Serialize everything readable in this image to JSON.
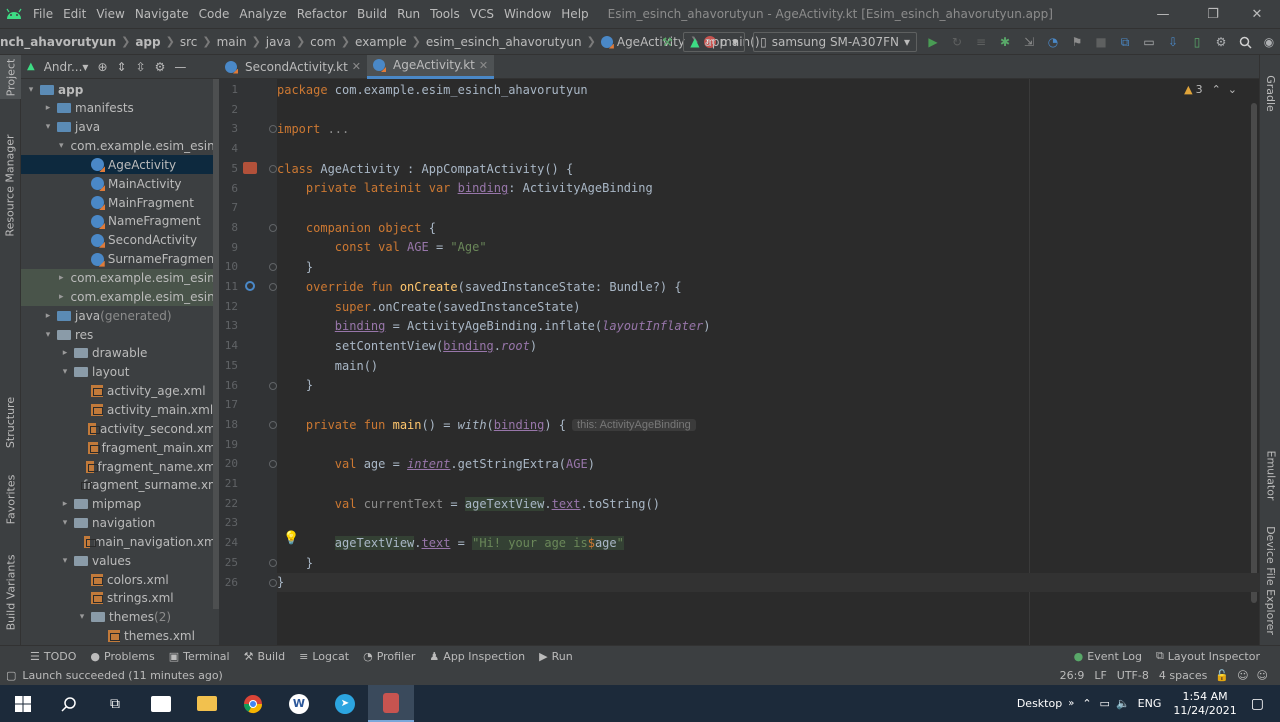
{
  "menu": {
    "items": [
      "File",
      "Edit",
      "View",
      "Navigate",
      "Code",
      "Analyze",
      "Refactor",
      "Build",
      "Run",
      "Tools",
      "VCS",
      "Window",
      "Help"
    ],
    "title": "Esim_esinch_ahavorutyun - AgeActivity.kt [Esim_esinch_ahavorutyun.app]"
  },
  "nav": {
    "crumbs": [
      "nch_ahavorutyun",
      "app",
      "src",
      "main",
      "java",
      "com",
      "example",
      "esim_esinch_ahavorutyun",
      "AgeActivity",
      "main()"
    ],
    "run_config": "app",
    "device": "samsung SM-A307FN"
  },
  "left_tabs": {
    "project": "Project",
    "resource_manager": "Resource Manager",
    "structure": "Structure",
    "favorites": "Favorites",
    "build_variants": "Build Variants"
  },
  "right_tabs": {
    "gradle": "Gradle",
    "emulator": "Emulator",
    "device_file_explorer": "Device File Explorer"
  },
  "project": {
    "view": "Andr...▾",
    "tree": [
      {
        "label": "app",
        "extra": "",
        "arrow": "▾",
        "icon": "folder-blue",
        "indent": 0
      },
      {
        "label": "manifests",
        "extra": "",
        "arrow": "▸",
        "icon": "folder-blue",
        "indent": 1
      },
      {
        "label": "java",
        "extra": "",
        "arrow": "▾",
        "icon": "folder-blue",
        "indent": 1
      },
      {
        "label": "com.example.esim_esinch",
        "extra": "",
        "arrow": "▾",
        "icon": "package",
        "indent": 2
      },
      {
        "label": "AgeActivity",
        "extra": "",
        "arrow": "",
        "icon": "kotlin-file",
        "indent": 3,
        "state": "sel"
      },
      {
        "label": "MainActivity",
        "extra": "",
        "arrow": "",
        "icon": "kotlin-file",
        "indent": 3
      },
      {
        "label": "MainFragment",
        "extra": "",
        "arrow": "",
        "icon": "kotlin-file",
        "indent": 3
      },
      {
        "label": "NameFragment",
        "extra": "",
        "arrow": "",
        "icon": "kotlin-file",
        "indent": 3
      },
      {
        "label": "SecondActivity",
        "extra": "",
        "arrow": "",
        "icon": "kotlin-file",
        "indent": 3
      },
      {
        "label": "SurnameFragment",
        "extra": "",
        "arrow": "",
        "icon": "kotlin-file",
        "indent": 3
      },
      {
        "label": "com.example.esim_esinch",
        "extra": "",
        "arrow": "▸",
        "icon": "package",
        "indent": 2,
        "state": "hl"
      },
      {
        "label": "com.example.esim_esinch",
        "extra": "",
        "arrow": "▸",
        "icon": "package",
        "indent": 2,
        "state": "hl"
      },
      {
        "label": "java",
        "extra": " (generated)",
        "arrow": "▸",
        "icon": "folder-blue",
        "indent": 1
      },
      {
        "label": "res",
        "extra": "",
        "arrow": "▾",
        "icon": "folder",
        "indent": 1
      },
      {
        "label": "drawable",
        "extra": "",
        "arrow": "▸",
        "icon": "folder",
        "indent": 2
      },
      {
        "label": "layout",
        "extra": "",
        "arrow": "▾",
        "icon": "folder",
        "indent": 2
      },
      {
        "label": "activity_age.xml",
        "extra": "",
        "arrow": "",
        "icon": "xml",
        "indent": 3
      },
      {
        "label": "activity_main.xml",
        "extra": "",
        "arrow": "",
        "icon": "xml",
        "indent": 3
      },
      {
        "label": "activity_second.xml",
        "extra": "",
        "arrow": "",
        "icon": "xml",
        "indent": 3
      },
      {
        "label": "fragment_main.xml",
        "extra": "",
        "arrow": "",
        "icon": "xml",
        "indent": 3
      },
      {
        "label": "fragment_name.xml",
        "extra": "",
        "arrow": "",
        "icon": "xml",
        "indent": 3
      },
      {
        "label": "fragment_surname.xm",
        "extra": "",
        "arrow": "",
        "icon": "xml",
        "indent": 3
      },
      {
        "label": "mipmap",
        "extra": "",
        "arrow": "▸",
        "icon": "folder",
        "indent": 2
      },
      {
        "label": "navigation",
        "extra": "",
        "arrow": "▾",
        "icon": "folder",
        "indent": 2
      },
      {
        "label": "main_navigation.xml",
        "extra": "",
        "arrow": "",
        "icon": "xml",
        "indent": 3
      },
      {
        "label": "values",
        "extra": "",
        "arrow": "▾",
        "icon": "folder",
        "indent": 2
      },
      {
        "label": "colors.xml",
        "extra": "",
        "arrow": "",
        "icon": "xml",
        "indent": 3
      },
      {
        "label": "strings.xml",
        "extra": "",
        "arrow": "",
        "icon": "xml",
        "indent": 3
      },
      {
        "label": "themes",
        "extra": " (2)",
        "arrow": "▾",
        "icon": "folder",
        "indent": 3
      },
      {
        "label": "themes.xml",
        "extra": "",
        "arrow": "",
        "icon": "xml",
        "indent": 4
      }
    ]
  },
  "tabs": [
    {
      "label": "SecondActivity.kt",
      "active": false
    },
    {
      "label": "AgeActivity.kt",
      "active": true
    }
  ],
  "editor": {
    "warnings": "3",
    "current_line": 26,
    "lines": [
      [
        [
          "kw",
          "package "
        ],
        [
          "",
          "com.example.esim_esinch_ahavorutyun"
        ]
      ],
      [],
      [
        [
          "kw",
          "import "
        ],
        [
          "muted",
          "..."
        ]
      ],
      [],
      [
        [
          "kw",
          "class "
        ],
        [
          "",
          "AgeActivity : AppCompatActivity() {"
        ]
      ],
      [
        [
          "",
          "    "
        ],
        [
          "kw",
          "private lateinit var "
        ],
        [
          "prop ul",
          "binding"
        ],
        [
          "",
          ": ActivityAgeBinding"
        ]
      ],
      [],
      [
        [
          "",
          "    "
        ],
        [
          "kw",
          "companion object "
        ],
        [
          "",
          "{"
        ]
      ],
      [
        [
          "",
          "        "
        ],
        [
          "kw",
          "const val "
        ],
        [
          "prop",
          "AGE"
        ],
        [
          "",
          " = "
        ],
        [
          "str",
          "\"Age\""
        ]
      ],
      [
        [
          "",
          "    }"
        ]
      ],
      [
        [
          "",
          "    "
        ],
        [
          "kw",
          "override fun "
        ],
        [
          "fn",
          "onCreate"
        ],
        [
          "",
          "(savedInstanceState: Bundle?) {"
        ]
      ],
      [
        [
          "",
          "        "
        ],
        [
          "kw",
          "super"
        ],
        [
          "",
          ".onCreate(savedInstanceState)"
        ]
      ],
      [
        [
          "",
          "        "
        ],
        [
          "prop ul",
          "binding"
        ],
        [
          "",
          " = ActivityAgeBinding.inflate("
        ],
        [
          "prop it",
          "layoutInflater"
        ],
        [
          "",
          ")"
        ]
      ],
      [
        [
          "",
          "        setContentView("
        ],
        [
          "prop ul",
          "binding"
        ],
        [
          "",
          "."
        ],
        [
          "prop it",
          "root"
        ],
        [
          "",
          ")"
        ]
      ],
      [
        [
          "",
          "        main()"
        ]
      ],
      [
        [
          "",
          "    }"
        ]
      ],
      [],
      [
        [
          "",
          "    "
        ],
        [
          "kw",
          "private fun "
        ],
        [
          "fn",
          "main"
        ],
        [
          "",
          "() = "
        ],
        [
          "it",
          "with"
        ],
        [
          "",
          "("
        ],
        [
          "prop ul",
          "binding"
        ],
        [
          "",
          ") {"
        ],
        [
          "hint",
          "this: ActivityAgeBinding"
        ]
      ],
      [],
      [
        [
          "",
          "        "
        ],
        [
          "kw",
          "val "
        ],
        [
          "",
          "age = "
        ],
        [
          "prop it ul",
          "intent"
        ],
        [
          "",
          ".getStringExtra("
        ],
        [
          "prop",
          "AGE"
        ],
        [
          "",
          ")"
        ]
      ],
      [],
      [
        [
          "",
          "        "
        ],
        [
          "kw",
          "val "
        ],
        [
          "muted",
          "currentText"
        ],
        [
          "",
          " = "
        ],
        [
          "weakbg",
          "ageTextView"
        ],
        [
          "",
          "."
        ],
        [
          "prop ul",
          "text"
        ],
        [
          "",
          ".toString()"
        ]
      ],
      [],
      [
        [
          "",
          "        "
        ],
        [
          "weakbg",
          "ageTextView"
        ],
        [
          "",
          "."
        ],
        [
          "prop ul",
          "text"
        ],
        [
          "",
          " = "
        ],
        [
          "str weakbg",
          "\"Hi! your age is"
        ],
        [
          "kw weakbg",
          "$"
        ],
        [
          "weakbg",
          "age"
        ],
        [
          "str weakbg",
          "\""
        ]
      ],
      [
        [
          "",
          "    }"
        ]
      ],
      [
        [
          "",
          "}"
        ]
      ]
    ]
  },
  "tool_windows": [
    "TODO",
    "Problems",
    "Terminal",
    "Build",
    "Logcat",
    "Profiler",
    "App Inspection",
    "Run"
  ],
  "tool_windows_right": [
    "Event Log",
    "Layout Inspector"
  ],
  "status": {
    "message": "Launch succeeded (11 minutes ago)",
    "position": "26:9",
    "line_sep": "LF",
    "encoding": "UTF-8",
    "indent": "4 spaces"
  },
  "taskbar": {
    "desktop": "Desktop",
    "lang": "ENG",
    "time": "1:54 AM",
    "date": "11/24/2021",
    "chevron": "»"
  },
  "colors": {
    "accent": "#4a88c7",
    "keyword": "#cc7832",
    "function": "#ffc66d",
    "string": "#6a8759",
    "property": "#9876aa"
  }
}
